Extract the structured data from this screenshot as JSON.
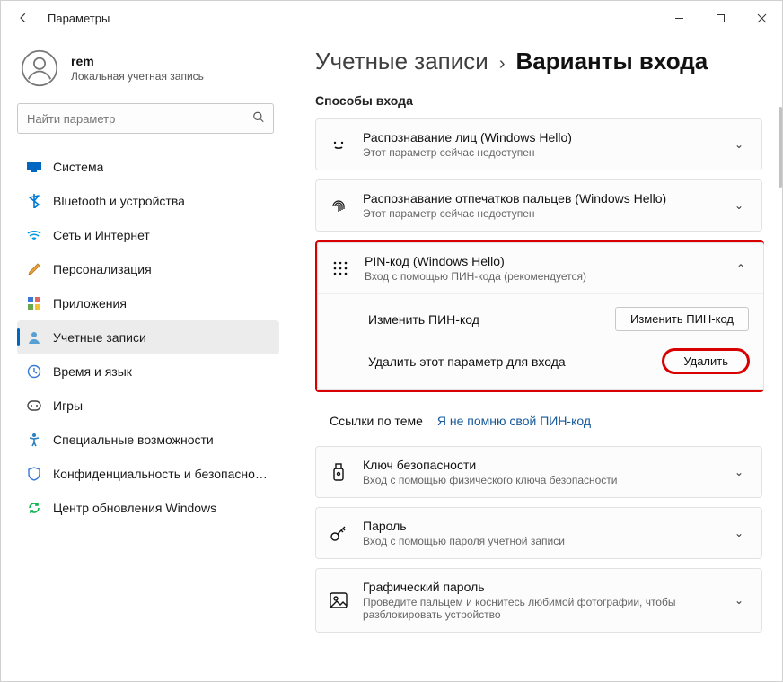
{
  "window": {
    "title": "Параметры"
  },
  "user": {
    "name": "rem",
    "subtitle": "Локальная учетная запись"
  },
  "search": {
    "placeholder": "Найти параметр"
  },
  "sidebar": {
    "items": [
      {
        "label": "Система"
      },
      {
        "label": "Bluetooth и устройства"
      },
      {
        "label": "Сеть и Интернет"
      },
      {
        "label": "Персонализация"
      },
      {
        "label": "Приложения"
      },
      {
        "label": "Учетные записи"
      },
      {
        "label": "Время и язык"
      },
      {
        "label": "Игры"
      },
      {
        "label": "Специальные возможности"
      },
      {
        "label": "Конфиденциальность и безопасность"
      },
      {
        "label": "Центр обновления Windows"
      }
    ]
  },
  "breadcrumb": {
    "parent": "Учетные записи",
    "current": "Варианты входа"
  },
  "section_label": "Способы входа",
  "methods": {
    "face": {
      "title": "Распознавание лиц (Windows Hello)",
      "sub": "Этот параметр сейчас недоступен"
    },
    "finger": {
      "title": "Распознавание отпечатков пальцев (Windows Hello)",
      "sub": "Этот параметр сейчас недоступен"
    },
    "pin": {
      "title": "PIN-код (Windows Hello)",
      "sub": "Вход с помощью ПИН-кода (рекомендуется)",
      "change_label": "Изменить ПИН-код",
      "change_btn": "Изменить ПИН-код",
      "remove_label": "Удалить этот параметр для входа",
      "remove_btn": "Удалить"
    },
    "secKey": {
      "title": "Ключ безопасности",
      "sub": "Вход с помощью физического ключа безопасности"
    },
    "password": {
      "title": "Пароль",
      "sub": "Вход с помощью пароля учетной записи"
    },
    "picture": {
      "title": "Графический пароль",
      "sub": "Проведите пальцем и коснитесь любимой фотографии, чтобы разблокировать устройство"
    }
  },
  "links": {
    "label": "Ссылки по теме",
    "forgot": "Я не помню свой ПИН-код"
  }
}
